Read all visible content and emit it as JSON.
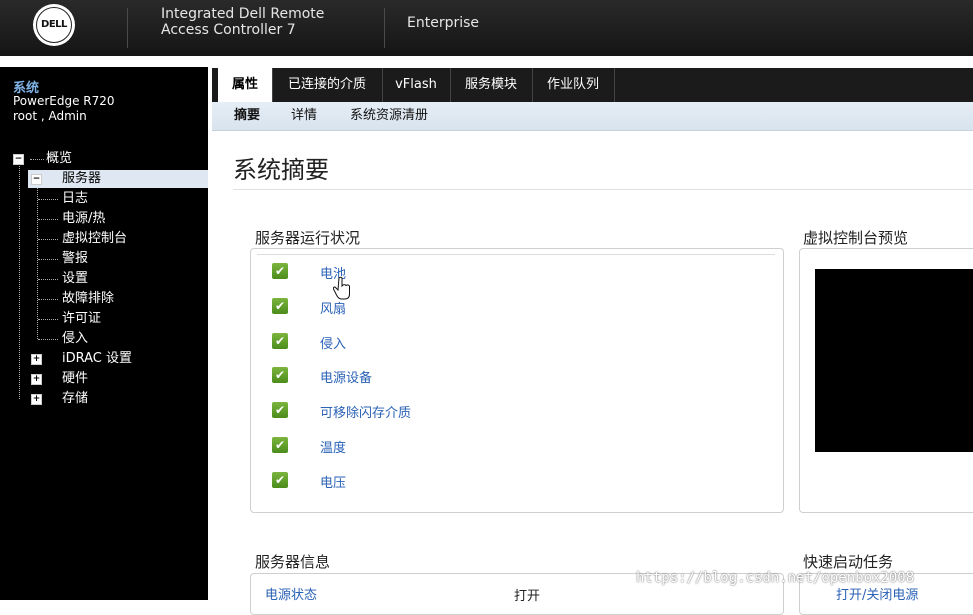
{
  "header": {
    "logo_text": "DELL",
    "product_line1": "Integrated Dell Remote",
    "product_line2": "Access Controller 7",
    "edition": "Enterprise"
  },
  "sidebar": {
    "title": "系统",
    "model": "PowerEdge R720",
    "user": "root , Admin",
    "tree": {
      "overview": "概览",
      "server": "服务器",
      "children": [
        "日志",
        "电源/热",
        "虚拟控制台",
        "警报",
        "设置",
        "故障排除",
        "许可证",
        "侵入"
      ],
      "idrac": "iDRAC 设置",
      "hardware": "硬件",
      "storage": "存储"
    }
  },
  "tabs": [
    "属性",
    "已连接的介质",
    "vFlash",
    "服务模块",
    "作业队列"
  ],
  "subtabs": [
    "摘要",
    "详情",
    "系统资源清册"
  ],
  "page_title": "系统摘要",
  "health": {
    "title": "服务器运行状况",
    "items": [
      "电池",
      "风扇",
      "侵入",
      "电源设备",
      "可移除闪存介质",
      "温度",
      "电压"
    ]
  },
  "console": {
    "title": "虚拟控制台预览"
  },
  "server_info": {
    "title": "服务器信息",
    "row_label": "电源状态",
    "row_value": "打开"
  },
  "quick_launch": {
    "title": "快速启动任务",
    "first_task": "打开/关闭电源"
  },
  "watermark": "https://blog.csdn.net/openbox2008",
  "colors": {
    "link": "#2a62b6",
    "check": "#5a9a28",
    "sidebar_title": "#7fb2e6"
  }
}
